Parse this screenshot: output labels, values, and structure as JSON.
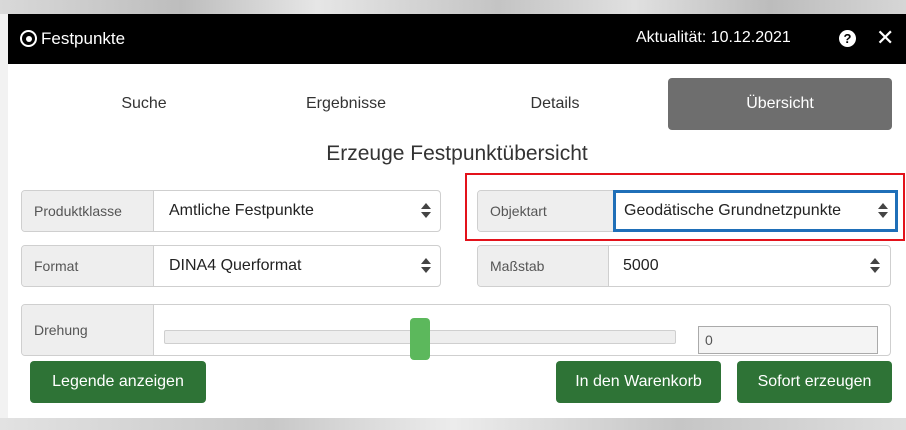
{
  "window": {
    "title": "Festpunkte",
    "actuality": "Aktualität: 10.12.2021",
    "help_glyph": "?",
    "close_glyph": "✕"
  },
  "tabs": [
    {
      "label": "Suche",
      "active": false
    },
    {
      "label": "Ergebnisse",
      "active": false
    },
    {
      "label": "Details",
      "active": false
    },
    {
      "label": "Übersicht",
      "active": true
    }
  ],
  "section_title": "Erzeuge Festpunktübersicht",
  "form": {
    "produktklasse": {
      "label": "Produktklasse",
      "value": "Amtliche Festpunkte"
    },
    "objektart": {
      "label": "Objektart",
      "value": "Geodätische Grundnetzpunkte"
    },
    "format": {
      "label": "Format",
      "value": "DINA4 Querformat"
    },
    "massstab": {
      "label": "Maßstab",
      "value": "5000"
    },
    "drehung": {
      "label": "Drehung",
      "value": "0",
      "slider_fraction": 0.5
    }
  },
  "buttons": {
    "legend": "Legende anzeigen",
    "cart": "In den Warenkorb",
    "create": "Sofort erzeugen"
  },
  "colors": {
    "titlebar": "#000000",
    "active_tab": "#6e6e6e",
    "button_green": "#2e7336",
    "slider_handle": "#5cb85c",
    "highlight_red": "#e3121b",
    "highlight_blue": "#1f6fb8"
  },
  "icons": {
    "title": "target-icon",
    "help": "help-icon",
    "close": "close-icon",
    "select": "select-arrows-icon"
  }
}
